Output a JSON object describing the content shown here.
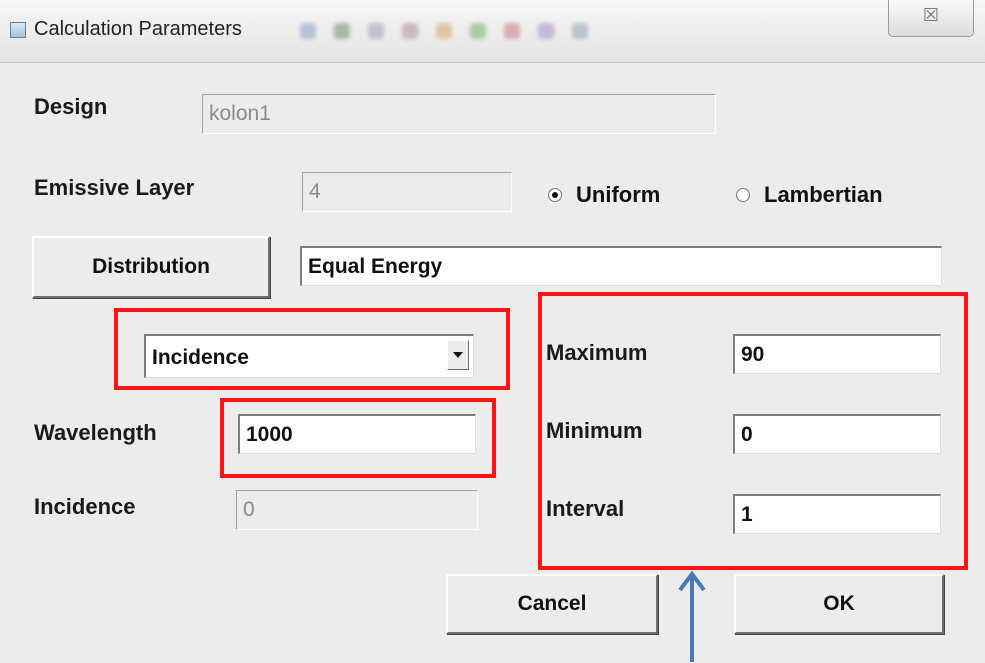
{
  "window": {
    "title": "Calculation Parameters",
    "close_glyph": "☒"
  },
  "form": {
    "design_label": "Design",
    "design_value": "kolon1",
    "emissive_label": "Emissive Layer",
    "emissive_value": "4",
    "radio_uniform": "Uniform",
    "radio_lambertian": "Lambertian",
    "radio_selected": "Uniform",
    "distribution_button": "Distribution",
    "distribution_value": "Equal Energy",
    "mode_select_value": "Incidence",
    "wavelength_label": "Wavelength",
    "wavelength_value": "1000",
    "incidence_label": "Incidence",
    "incidence_value": "0",
    "maximum_label": "Maximum",
    "maximum_value": "90",
    "minimum_label": "Minimum",
    "minimum_value": "0",
    "interval_label": "Interval",
    "interval_value": "1"
  },
  "buttons": {
    "cancel": "Cancel",
    "ok": "OK"
  },
  "annotations": {
    "highlight_color": "#ff1414",
    "arrow_color": "#4a7ab8"
  },
  "icons": {
    "title": "app-window-icon",
    "close": "close-icon",
    "dropdown": "chevron-down-icon",
    "pointer": "up-arrow-icon"
  }
}
